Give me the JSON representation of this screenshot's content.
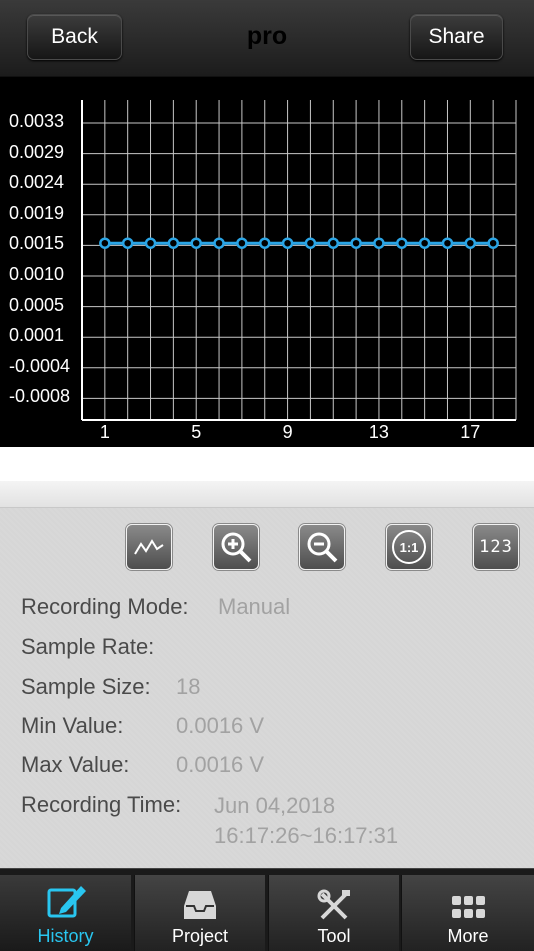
{
  "nav": {
    "back_label": "Back",
    "title": "pro",
    "share_label": "Share"
  },
  "chart_data": {
    "type": "line",
    "y_ticks": [
      "0.0033",
      "0.0029",
      "0.0024",
      "0.0019",
      "0.0015",
      "0.0010",
      "0.0005",
      "0.0001",
      "-0.0004",
      "-0.0008"
    ],
    "x_ticks": [
      "1",
      "5",
      "9",
      "13",
      "17"
    ],
    "x": [
      1,
      2,
      3,
      4,
      5,
      6,
      7,
      8,
      9,
      10,
      11,
      12,
      13,
      14,
      15,
      16,
      17,
      18
    ],
    "series": [
      {
        "values": [
          0.0016,
          0.0016,
          0.0016,
          0.0016,
          0.0016,
          0.0016,
          0.0016,
          0.0016,
          0.0016,
          0.0016,
          0.0016,
          0.0016,
          0.0016,
          0.0016,
          0.0016,
          0.0016,
          0.0016,
          0.0016
        ]
      }
    ],
    "ylim": [
      -0.0008,
      0.0033
    ],
    "grid": true,
    "line_color": "#2aa5e6"
  },
  "tools": [
    "line-chart-icon",
    "zoom-in-icon",
    "zoom-out-icon",
    "reset-zoom-icon",
    "numeric-view-icon"
  ],
  "tool_texts": {
    "reset": "1:1",
    "numeric": "123"
  },
  "info": {
    "recording_mode_label": "Recording Mode:",
    "recording_mode_value": "Manual",
    "sample_rate_label": "Sample Rate:",
    "sample_size_label": "Sample Size:",
    "sample_size_value": "18",
    "min_value_label": "Min Value:",
    "min_value_value": "0.0016 V",
    "max_value_label": "Max Value:",
    "max_value_value": "0.0016 V",
    "recording_time_label": "Recording Time:",
    "recording_time_date": "Jun 04,2018",
    "recording_time_range": "16:17:26~16:17:31"
  },
  "tabs": [
    {
      "label": "History",
      "icon": "edit-icon",
      "active": true
    },
    {
      "label": "Project",
      "icon": "inbox-icon",
      "active": false
    },
    {
      "label": "Tool",
      "icon": "tools-icon",
      "active": false
    },
    {
      "label": "More",
      "icon": "grid-icon",
      "active": false
    }
  ]
}
